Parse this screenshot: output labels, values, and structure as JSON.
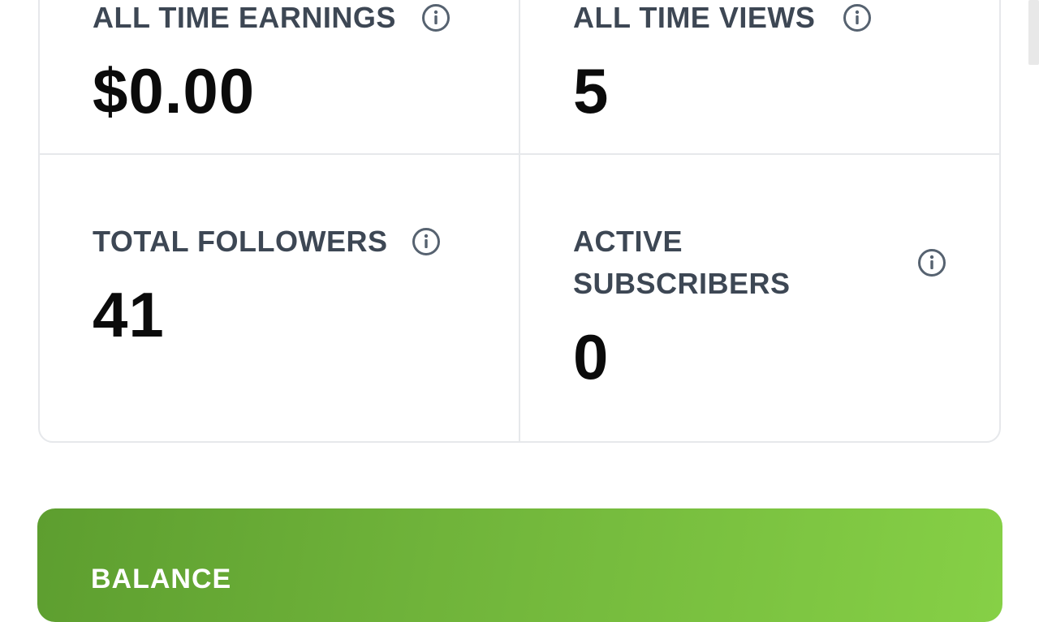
{
  "stats": {
    "earnings": {
      "label": "ALL TIME EARNINGS",
      "value": "$0.00"
    },
    "views": {
      "label": "ALL TIME VIEWS",
      "value": "5"
    },
    "followers": {
      "label": "TOTAL FOLLOWERS",
      "value": "41"
    },
    "subscribers": {
      "label_line1": "ACTIVE",
      "label_line2": "SUBSCRIBERS",
      "value": "0"
    }
  },
  "balance": {
    "label": "BALANCE"
  },
  "icons": {
    "info": "info-circle-icon"
  },
  "colors": {
    "label_text": "#3d4754",
    "value_text": "#0b0b0b",
    "card_border": "#e6e8eb",
    "balance_gradient_start": "#5d9e2f",
    "balance_gradient_end": "#86d046"
  }
}
